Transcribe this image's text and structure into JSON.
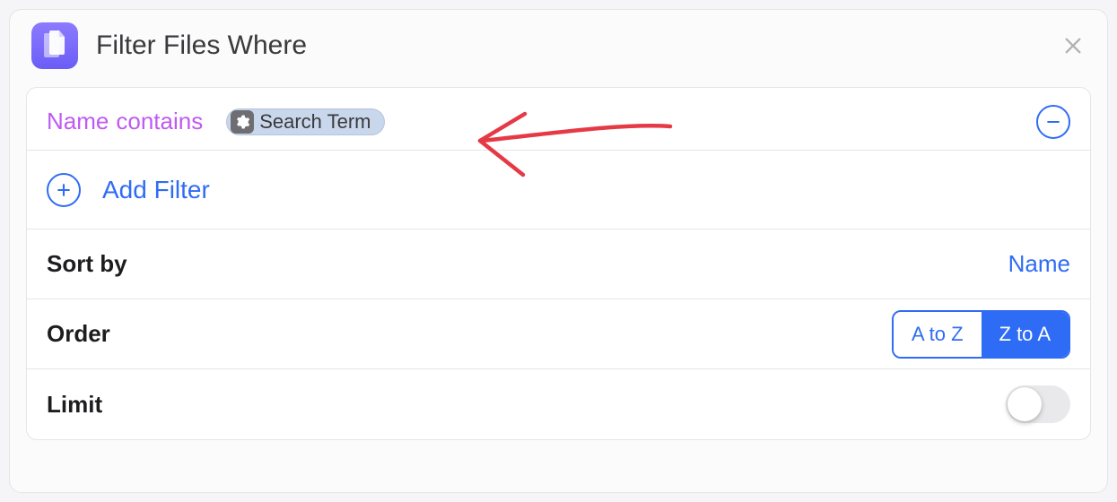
{
  "header": {
    "title": "Filter Files Where"
  },
  "filter": {
    "field_label": "Name",
    "operator_label": "contains",
    "token_label": "Search Term"
  },
  "add_filter": {
    "label": "Add Filter"
  },
  "sort": {
    "label": "Sort by",
    "value": "Name"
  },
  "order": {
    "label": "Order",
    "options": [
      "A to Z",
      "Z to A"
    ],
    "selected_index": 1
  },
  "limit": {
    "label": "Limit",
    "on": false
  }
}
